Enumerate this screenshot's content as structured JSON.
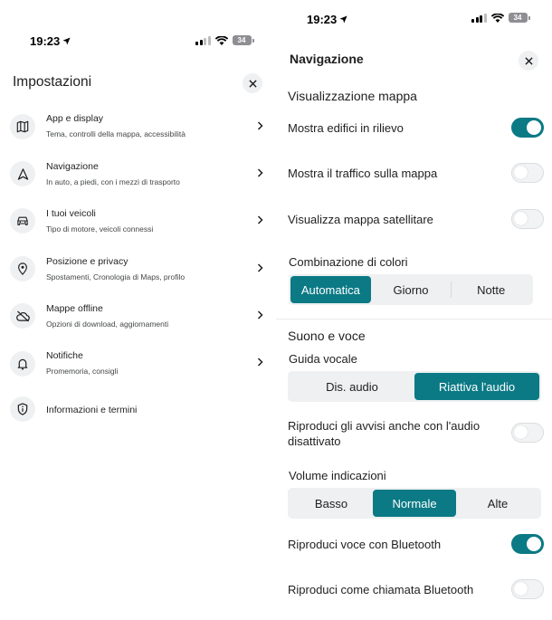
{
  "colors": {
    "accent": "#0b7a85",
    "text": "#1f1f1f",
    "icon_bg": "#eef0f1"
  },
  "left": {
    "status": {
      "time": "19:23",
      "battery": "34"
    },
    "title": "Impostazioni",
    "menu": [
      {
        "icon": "map-icon",
        "label": "App e display",
        "sub": "Tema, controlli della mappa, accessibilità"
      },
      {
        "icon": "navigation-arrow-icon",
        "label": "Navigazione",
        "sub": "In auto, a piedi, con i mezzi di trasporto"
      },
      {
        "icon": "car-icon",
        "label": "I tuoi veicoli",
        "sub": "Tipo di motore, veicoli connessi"
      },
      {
        "icon": "location-pin-icon",
        "label": "Posizione e privacy",
        "sub": "Spostamenti, Cronologia di Maps, profilo"
      },
      {
        "icon": "cloud-off-icon",
        "label": "Mappe offline",
        "sub": "Opzioni di download, aggiornamenti"
      },
      {
        "icon": "bell-icon",
        "label": "Notifiche",
        "sub": "Promemoria, consigli"
      },
      {
        "icon": "info-shield-icon",
        "label": "Informazioni e termini",
        "sub": ""
      }
    ]
  },
  "right": {
    "status": {
      "time": "19:23",
      "battery": "34"
    },
    "title": "Navigazione",
    "map_section": "Visualizzazione mappa",
    "toggles_top": [
      {
        "label": "Mostra edifici in rilievo",
        "on": true
      },
      {
        "label": "Mostra il traffico sulla mappa",
        "on": false
      },
      {
        "label": "Visualizza mappa satellitare",
        "on": false
      }
    ],
    "color_scheme": {
      "label": "Combinazione di colori",
      "options": [
        "Automatica",
        "Giorno",
        "Notte"
      ],
      "selected": 0
    },
    "sound_section": "Suono e voce",
    "voice_guide": {
      "label": "Guida vocale",
      "options": [
        "Dis. audio",
        "Riattiva l'audio"
      ],
      "selected": 1
    },
    "alerts_toggle": {
      "label_line1": "Riproduci gli avvisi anche con l'audio",
      "label_line2": "disattivato",
      "on": false
    },
    "volume": {
      "label": "Volume indicazioni",
      "options": [
        "Basso",
        "Normale",
        "Alte"
      ],
      "selected": 1
    },
    "toggles_bottom": [
      {
        "label": "Riproduci voce con Bluetooth",
        "on": true
      },
      {
        "label": "Riproduci come chiamata Bluetooth",
        "on": false
      }
    ]
  }
}
